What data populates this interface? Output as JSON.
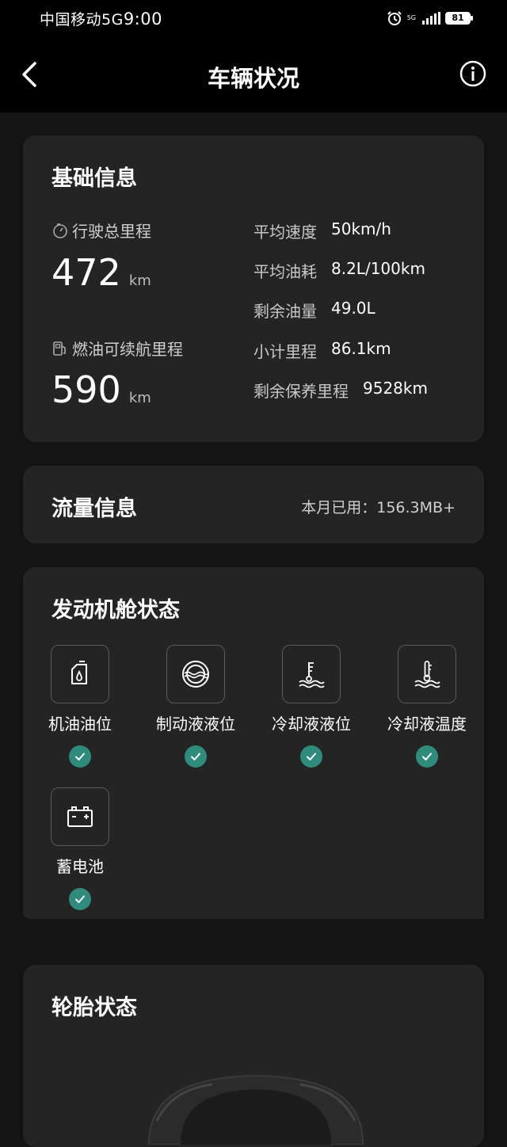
{
  "status_bar": {
    "carrier": "中国移动5G",
    "time": "9:00",
    "network": "5G",
    "battery": "81"
  },
  "header": {
    "title": "车辆状况",
    "back_icon": "chevron-left-icon",
    "info_icon": "info-icon"
  },
  "basic_info": {
    "title": "基础信息",
    "total_mileage_label": "行驶总里程",
    "total_mileage_value": "472",
    "total_mileage_unit": "km",
    "fuel_range_label": "燃油可续航里程",
    "fuel_range_value": "590",
    "fuel_range_unit": "km",
    "stats": [
      {
        "label": "平均速度",
        "value": "50km/h"
      },
      {
        "label": "平均油耗",
        "value": "8.2L/100km"
      },
      {
        "label": "剩余油量",
        "value": "49.0L"
      },
      {
        "label": "小计里程",
        "value": "86.1km"
      },
      {
        "label": "剩余保养里程",
        "value": "9528km"
      }
    ]
  },
  "traffic": {
    "title": "流量信息",
    "usage": "本月已用：156.3MB+"
  },
  "engine": {
    "title": "发动机舱状态",
    "items": [
      {
        "label": "机油油位",
        "icon": "oil-can-icon",
        "status": "ok"
      },
      {
        "label": "制动液液位",
        "icon": "brake-fluid-icon",
        "status": "ok"
      },
      {
        "label": "冷却液液位",
        "icon": "coolant-level-icon",
        "status": "ok"
      },
      {
        "label": "冷却液温度",
        "icon": "coolant-temp-icon",
        "status": "ok"
      },
      {
        "label": "蓄电池",
        "icon": "battery-icon",
        "status": "ok"
      }
    ]
  },
  "tires": {
    "title": "轮胎状态"
  },
  "colors": {
    "accent_check": "#2f8c7d",
    "card_bg": "#242424",
    "page_bg": "#141414"
  }
}
